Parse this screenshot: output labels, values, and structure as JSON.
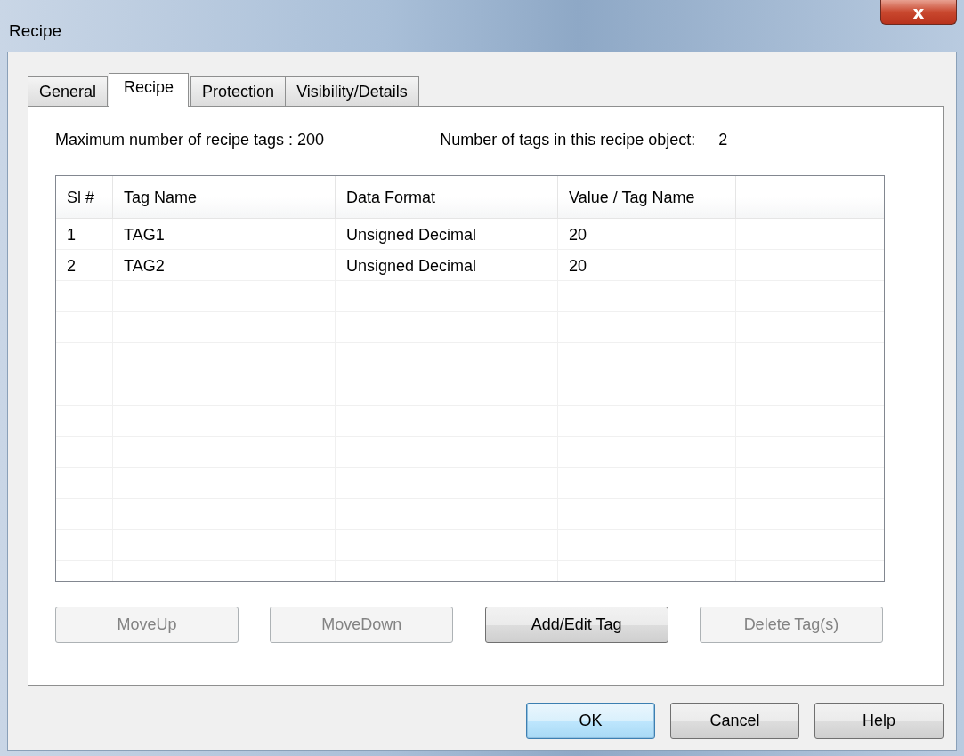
{
  "window": {
    "title": "Recipe",
    "close_label": "x"
  },
  "tabs": [
    {
      "label": "General",
      "selected": false
    },
    {
      "label": "Recipe",
      "selected": true
    },
    {
      "label": "Protection",
      "selected": false
    },
    {
      "label": "Visibility/Details",
      "selected": false
    }
  ],
  "info": {
    "max_tags": "Maximum number of recipe tags : 200",
    "tags_in_object_label": "Number of tags in this recipe object:",
    "tags_in_object_value": "2"
  },
  "table": {
    "columns": [
      "Sl #",
      "Tag Name",
      "Data Format",
      "Value / Tag Name"
    ],
    "rows": [
      [
        "1",
        "TAG1",
        "Unsigned Decimal",
        "20"
      ],
      [
        "2",
        "TAG2",
        "Unsigned Decimal",
        "20"
      ]
    ]
  },
  "tag_buttons": [
    {
      "label": "MoveUp",
      "disabled": true
    },
    {
      "label": "MoveDown",
      "disabled": true
    },
    {
      "label": "Add/Edit Tag",
      "disabled": false
    },
    {
      "label": "Delete Tag(s)",
      "disabled": true
    }
  ],
  "dialog_buttons": [
    {
      "label": "OK",
      "focused": true
    },
    {
      "label": "Cancel",
      "focused": false
    },
    {
      "label": "Help",
      "focused": false
    }
  ]
}
